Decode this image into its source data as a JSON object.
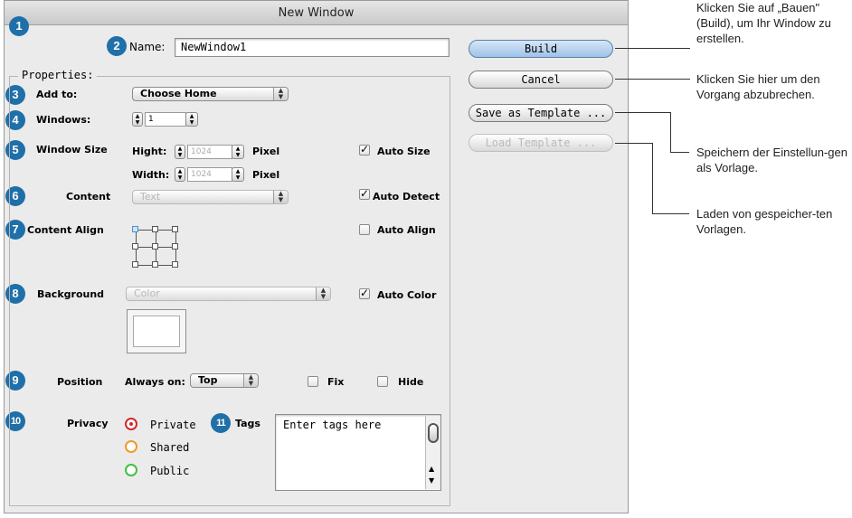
{
  "window": {
    "title": "New Window"
  },
  "badges": [
    "1",
    "2",
    "3",
    "4",
    "5",
    "6",
    "7",
    "8",
    "9",
    "10",
    "11"
  ],
  "name_field": {
    "label": "Name:",
    "value": "NewWindow1"
  },
  "properties": {
    "legend": "Properties:",
    "add_to": {
      "label": "Add to:",
      "value": "Choose Home"
    },
    "windows": {
      "label": "Windows:",
      "value": "1"
    },
    "window_size": {
      "label": "Window Size",
      "height_label": "Hight:",
      "height_value": "1024",
      "height_unit": "Pixel",
      "width_label": "Width:",
      "width_value": "1024",
      "width_unit": "Pixel",
      "auto_label": "Auto Size",
      "auto_checked": true
    },
    "content": {
      "label": "Content",
      "value": "Text",
      "auto_label": "Auto Detect",
      "auto_checked": true
    },
    "content_align": {
      "label": "Content Align",
      "auto_label": "Auto Align",
      "auto_checked": false
    },
    "background": {
      "label": "Background",
      "value": "Color",
      "auto_label": "Auto Color",
      "auto_checked": true
    },
    "position": {
      "label": "Position",
      "always_on_label": "Always on:",
      "always_on_value": "Top",
      "fix_label": "Fix",
      "hide_label": "Hide"
    },
    "privacy": {
      "label": "Privacy",
      "options": [
        {
          "label": "Private",
          "selected": true,
          "color": "#d42a2a"
        },
        {
          "label": "Shared",
          "selected": false,
          "color": "#f09a2a"
        },
        {
          "label": "Public",
          "selected": false,
          "color": "#3fc23f"
        }
      ]
    },
    "tags": {
      "label": "Tags",
      "placeholder": "Enter tags here"
    }
  },
  "buttons": {
    "build": "Build",
    "cancel": "Cancel",
    "save_template": "Save as Template ...",
    "load_template": "Load Template ..."
  },
  "callouts": {
    "build": "Klicken Sie auf „Bauen\" (Build), um Ihr Window zu erstellen.",
    "cancel": "Klicken Sie hier um den Vorgang abzubrechen.",
    "save": "Speichern der Einstellun-gen als Vorlage.",
    "load": "Laden von gespeicher-ten Vorlagen."
  },
  "colors": {
    "badge": "#1f6fa8",
    "default_button": "#9fc2e8"
  }
}
